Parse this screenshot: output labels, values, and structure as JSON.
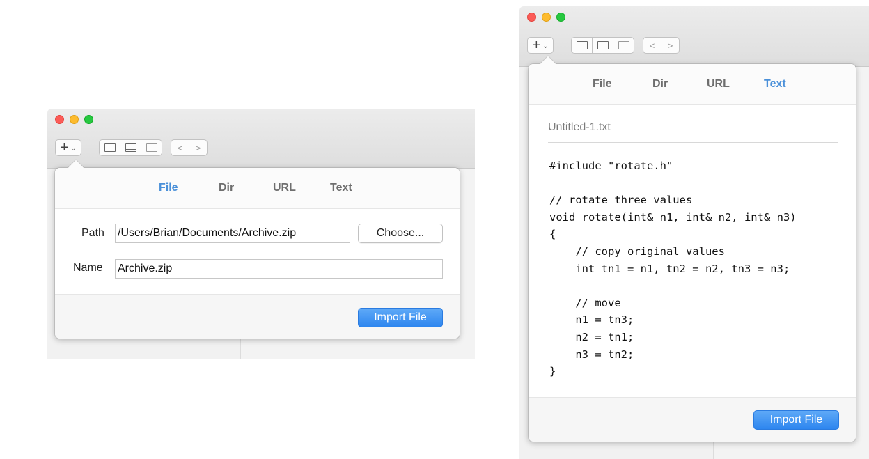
{
  "left_window": {
    "tabs": [
      {
        "label": "File",
        "active": true
      },
      {
        "label": "Dir",
        "active": false
      },
      {
        "label": "URL",
        "active": false
      },
      {
        "label": "Text",
        "active": false
      }
    ],
    "path_label": "Path",
    "path_value": "/Users/Brian/Documents/Archive.zip",
    "choose_label": "Choose...",
    "name_label": "Name",
    "name_value": "Archive.zip",
    "import_label": "Import File"
  },
  "right_window": {
    "tabs": [
      {
        "label": "File",
        "active": false
      },
      {
        "label": "Dir",
        "active": false
      },
      {
        "label": "URL",
        "active": false
      },
      {
        "label": "Text",
        "active": true
      }
    ],
    "filename": "Untitled-1.txt",
    "code": "#include \"rotate.h\"\n\n// rotate three values\nvoid rotate(int& n1, int& n2, int& n3)\n{\n    // copy original values\n    int tn1 = n1, tn2 = n2, tn3 = n3;\n\n    // move\n    n1 = tn3;\n    n2 = tn1;\n    n3 = tn2;\n}",
    "import_label": "Import File"
  },
  "toolbar": {
    "add_icon": "plus-icon",
    "add_chevron_icon": "chevron-down-icon",
    "layout_icons": [
      "sidebar-left-icon",
      "panel-bottom-icon",
      "sidebar-right-icon"
    ],
    "nav_back_glyph": "<",
    "nav_forward_glyph": ">"
  },
  "colors": {
    "accent_tab": "#4a90d9",
    "primary_button": "#2d86ef",
    "traffic_red": "#fc5b57",
    "traffic_yellow": "#fdbb2e",
    "traffic_green": "#27c840"
  }
}
